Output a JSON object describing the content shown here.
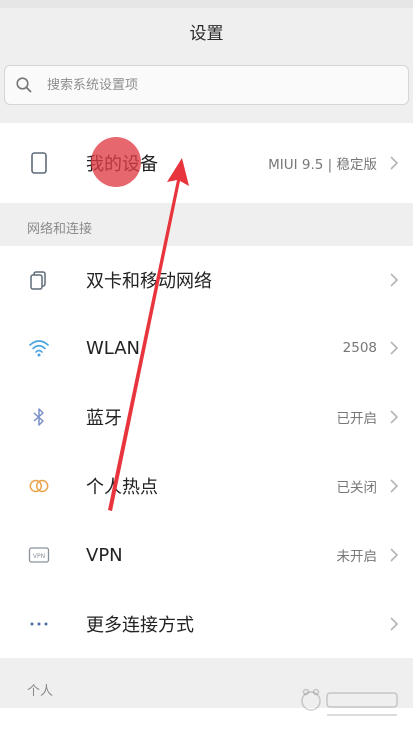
{
  "header": {
    "title": "设置"
  },
  "search": {
    "placeholder": "搜索系统设置项",
    "icon": "search-icon"
  },
  "device": {
    "label": "我的设备",
    "value": "MIUI 9.5 | 稳定版",
    "icon": "phone-icon"
  },
  "sections": {
    "network_title": "网络和连接",
    "personal_title": "个人"
  },
  "network": [
    {
      "label": "双卡和移动网络",
      "value": "",
      "icon": "sim-card-icon"
    },
    {
      "label": "WLAN",
      "value": "2508",
      "icon": "wifi-icon"
    },
    {
      "label": "蓝牙",
      "value": "已开启",
      "icon": "bluetooth-icon"
    },
    {
      "label": "个人热点",
      "value": "已关闭",
      "icon": "hotspot-icon"
    },
    {
      "label": "VPN",
      "value": "未开启",
      "icon": "vpn-icon"
    },
    {
      "label": "更多连接方式",
      "value": "",
      "icon": "more-dots-icon"
    }
  ],
  "colors": {
    "background": "#efefef",
    "card": "#ffffff",
    "annotation_red": "#e8343c",
    "wifi_icon": "#4aa3df",
    "hotspot_icon": "#e9a24b",
    "bluetooth_icon": "#7b8fc9"
  }
}
